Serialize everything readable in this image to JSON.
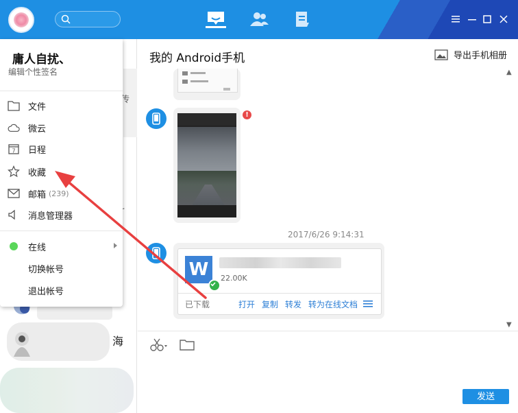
{
  "profile": {
    "name": "庸人自扰、",
    "signature": "编辑个性签名"
  },
  "menu": {
    "items": [
      {
        "label": "文件",
        "icon": "folder-icon"
      },
      {
        "label": "微云",
        "icon": "cloud-icon"
      },
      {
        "label": "日程",
        "icon": "calendar-icon",
        "icon_text": "7"
      },
      {
        "label": "收藏",
        "icon": "star-icon"
      },
      {
        "label": "邮箱",
        "count": "(239)",
        "icon": "mail-icon"
      },
      {
        "label": "消息管理器",
        "icon": "speaker-icon"
      }
    ],
    "status": {
      "label": "在线",
      "color": "#5ad65a"
    },
    "switch_account": "切换帐号",
    "logout": "退出帐号"
  },
  "left_list": {
    "peek_text_1": "传",
    "peek_text_2": "r",
    "contact_fragment": "海"
  },
  "chat": {
    "title": "我的 Android手机",
    "export_label": "导出手机相册",
    "error_mark": "!",
    "timestamp": "2017/6/26 9:14:31",
    "file": {
      "size": "22.00K",
      "status": "已下载",
      "actions": [
        "打开",
        "复制",
        "转发",
        "转为在线文档"
      ],
      "app_letter": "W"
    }
  },
  "input": {
    "send_label": "发送"
  },
  "colors": {
    "accent": "#1e8fe3",
    "link": "#2d7fd6",
    "annotation_arrow": "#e84040"
  }
}
